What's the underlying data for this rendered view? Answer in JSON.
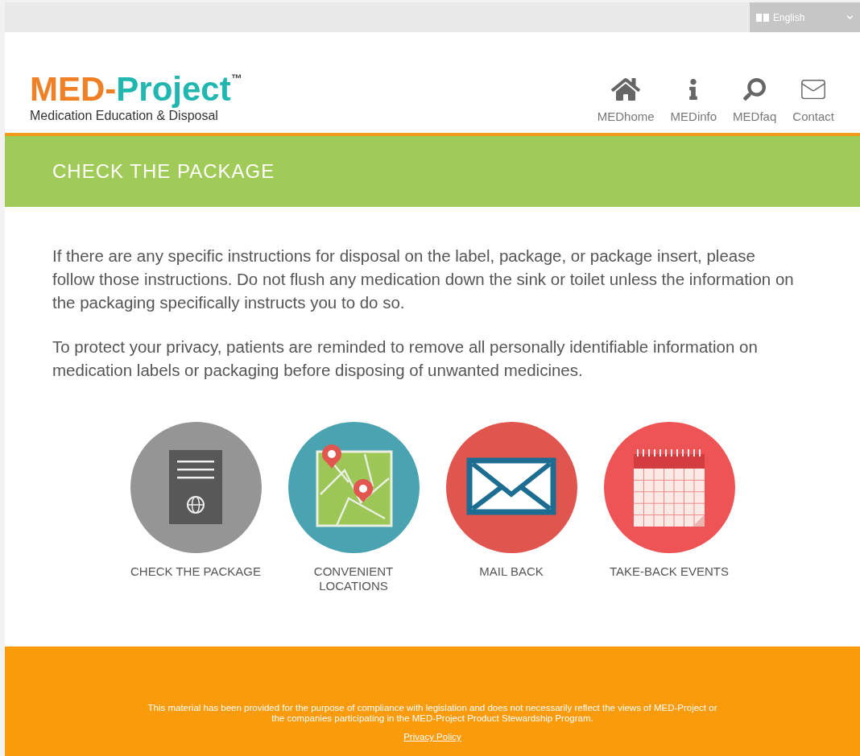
{
  "language_select": {
    "value": "English"
  },
  "logo": {
    "first": "MED-",
    "second": "Project",
    "mark": "™",
    "tagline": "Medication Education & Disposal"
  },
  "nav": [
    {
      "kind": "home",
      "label": "MEDhome"
    },
    {
      "kind": "info",
      "label": "MEDinfo"
    },
    {
      "kind": "search",
      "label": "MEDfaq"
    },
    {
      "kind": "mail",
      "label": "Contact"
    }
  ],
  "banner": {
    "title": "CHECK THE PACKAGE"
  },
  "paragraphs": [
    "If there are any specific instructions for disposal on the label, package, or package insert, please follow those instructions. Do not flush any medication down the sink or toilet unless the information on the packaging specifically instructs you to do so.",
    "To protect your privacy, patients are reminded to remove all personally identifiable information on medication labels or packaging before disposing of unwanted medicines."
  ],
  "tiles": [
    {
      "kind": "package",
      "label": "CHECK THE PACKAGE",
      "color": "#959595"
    },
    {
      "kind": "map",
      "label": "CONVENIENT LOCATIONS",
      "color": "#4aa3b1"
    },
    {
      "kind": "mail",
      "label": "MAIL BACK",
      "color": "#e0564f"
    },
    {
      "kind": "calendar",
      "label": "TAKE-BACK EVENTS",
      "color": "#ee5455"
    }
  ],
  "footer": {
    "disclaimer": "This material has been provided for the purpose of compliance with legislation and does not necessarily reflect the views of MED-Project or the companies participating in the MED-Project Product Stewardship Program.",
    "link": "Privacy Policy"
  }
}
